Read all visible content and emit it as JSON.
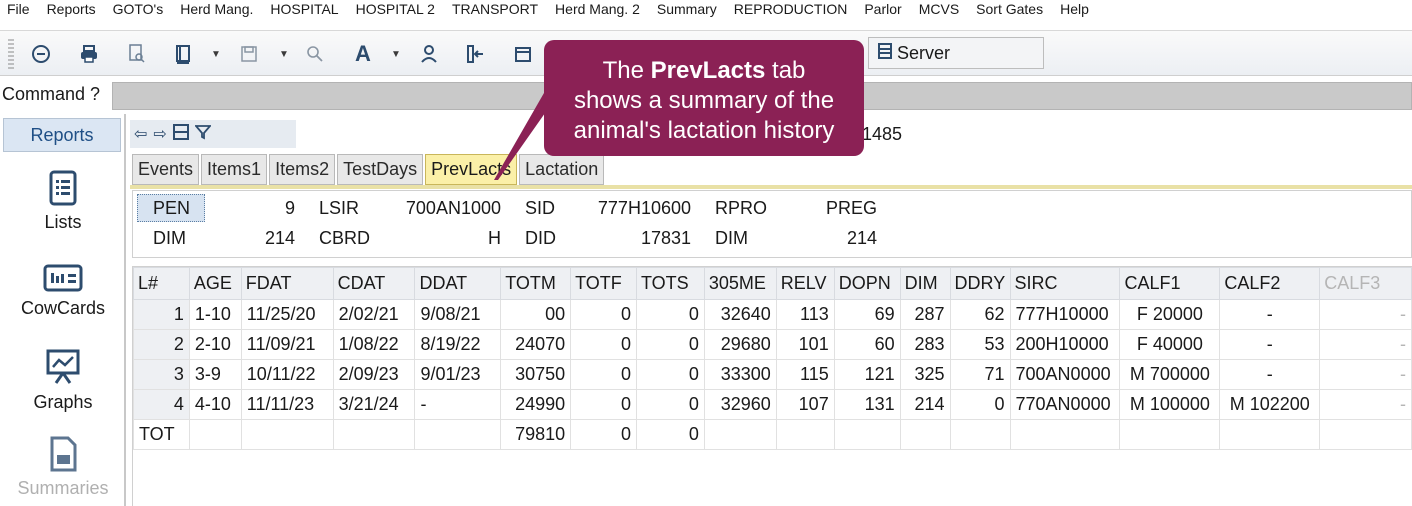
{
  "menu": [
    "File",
    "Reports",
    "GOTO's",
    "Herd Mang.",
    "HOSPITAL",
    "HOSPITAL 2",
    "TRANSPORT",
    "Herd Mang. 2",
    "Summary",
    "REPRODUCTION",
    "Parlor",
    "MCVS",
    "Sort Gates",
    "Help"
  ],
  "toolbar": {
    "server_label": "Server",
    "icons": [
      "back-circle-icon",
      "print-icon",
      "print-preview-icon",
      "book-icon",
      "save-icon",
      "search-icon",
      "font-icon",
      "person-icon",
      "import-icon",
      "calendar-icon",
      "server-icon"
    ]
  },
  "command": {
    "label": "Command ?",
    "value": ""
  },
  "nav": {
    "tab_label": "Reports",
    "items": [
      {
        "label": "Lists",
        "icon": "list-icon"
      },
      {
        "label": "CowCards",
        "icon": "cowcard-icon"
      },
      {
        "label": "Graphs",
        "icon": "graph-icon"
      },
      {
        "label": "Summaries",
        "icon": "summary-icon"
      }
    ]
  },
  "pane": {
    "id_value": "1485"
  },
  "tabs": [
    {
      "label": "Events",
      "active": false
    },
    {
      "label": "Items1",
      "active": false
    },
    {
      "label": "Items2",
      "active": false
    },
    {
      "label": "TestDays",
      "active": false
    },
    {
      "label": "PrevLacts",
      "active": true
    },
    {
      "label": "Lactation",
      "active": false
    }
  ],
  "summary": {
    "row1": [
      {
        "label": "PEN",
        "value": "9"
      },
      {
        "label": "LSIR",
        "value": "700AN1000"
      },
      {
        "label": "SID",
        "value": "777H10600"
      },
      {
        "label": "RPRO",
        "value": "PREG"
      }
    ],
    "row2": [
      {
        "label": "DIM",
        "value": "214"
      },
      {
        "label": "CBRD",
        "value": "H"
      },
      {
        "label": "DID",
        "value": "17831"
      },
      {
        "label": "DIM",
        "value": "214"
      }
    ]
  },
  "grid": {
    "headers": [
      "L#",
      "AGE",
      "FDAT",
      "CDAT",
      "DDAT",
      "TOTM",
      "TOTF",
      "TOTS",
      "305ME",
      "RELV",
      "DOPN",
      "DIM",
      "DDRY",
      "SIRC",
      "CALF1",
      "CALF2",
      "CALF3"
    ],
    "rows": [
      [
        "1",
        "1-10",
        "11/25/20",
        "2/02/21",
        "9/08/21",
        "00",
        "0",
        "0",
        "32640",
        "113",
        "69",
        "287",
        "62",
        "777H10000",
        "F 20000",
        "-",
        "-"
      ],
      [
        "2",
        "2-10",
        "11/09/21",
        "1/08/22",
        "8/19/22",
        "24070",
        "0",
        "0",
        "29680",
        "101",
        "60",
        "283",
        "53",
        "200H10000",
        "F 40000",
        "-",
        "-"
      ],
      [
        "3",
        "3-9",
        "10/11/22",
        "2/09/23",
        "9/01/23",
        "30750",
        "0",
        "0",
        "33300",
        "115",
        "121",
        "325",
        "71",
        "700AN0000",
        "M 700000",
        "-",
        "-"
      ],
      [
        "4",
        "4-10",
        "11/11/23",
        "3/21/24",
        "-",
        "24990",
        "0",
        "0",
        "32960",
        "107",
        "131",
        "214",
        "0",
        "770AN0000",
        "M 100000",
        "M 102200",
        "-"
      ]
    ],
    "total": [
      "TOT",
      "",
      "",
      "",
      "",
      "79810",
      "0",
      "0",
      "",
      "",
      "",
      "",
      "",
      "",
      "",
      "",
      ""
    ]
  },
  "callout": {
    "line1_pre": "The ",
    "line1_bold": "PrevLacts",
    "line1_post": " tab",
    "line2": "shows a summary of the",
    "line3": "animal's lactation history"
  },
  "colors": {
    "callout": "#8b2155",
    "active_tab": "#fbf0a8",
    "nav_tab": "#dbe6f3"
  }
}
